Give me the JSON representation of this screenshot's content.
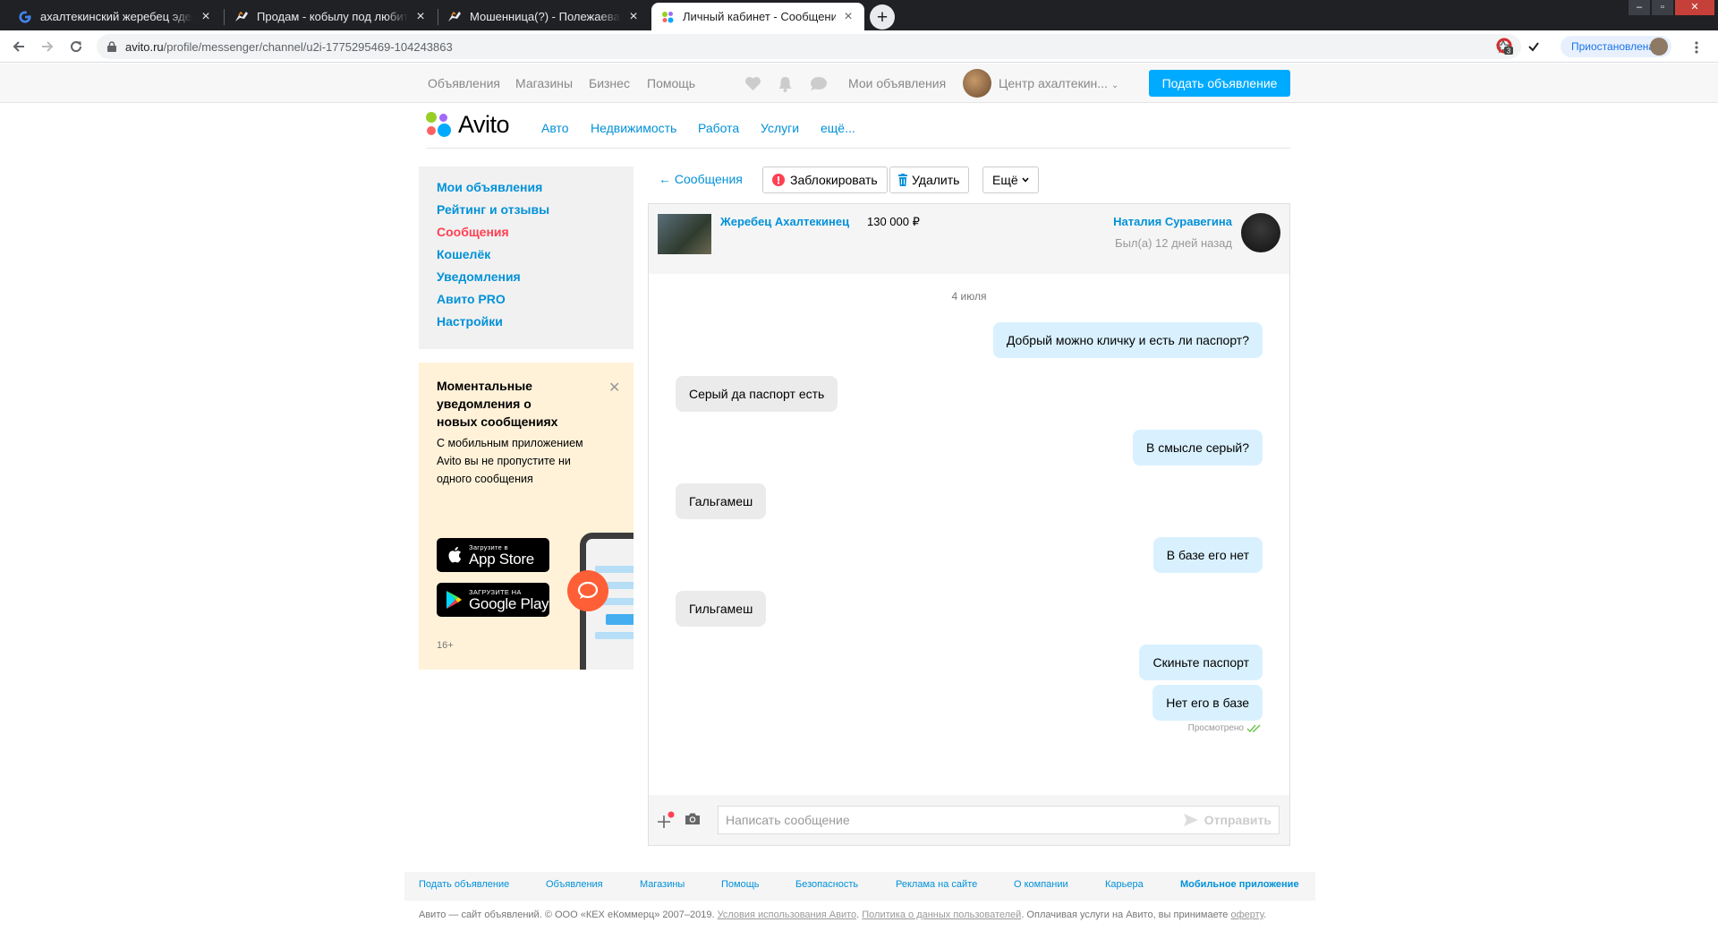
{
  "browser": {
    "tabs": [
      {
        "title": "ахалтекинский жеребец эдельвейс",
        "favicon": "google-icon"
      },
      {
        "title": "Продам - кобылу под любителя",
        "favicon": "horse-icon"
      },
      {
        "title": "Мошенница(?) - Полежаева Мария",
        "favicon": "horse-icon"
      },
      {
        "title": "Личный кабинет - Сообщения",
        "favicon": "avito-icon"
      }
    ],
    "url_host": "avito.ru",
    "url_path": "/profile/messenger/channel/u2i-1775295469-104243863",
    "ext_badge": "3",
    "profile_status": "Приостановлена"
  },
  "topbar": {
    "links": [
      "Объявления",
      "Магазины",
      "Бизнес",
      "Помощь"
    ],
    "my_ads": "Мои объявления",
    "user": "Центр ахалтекин...",
    "post_button": "Подать объявление"
  },
  "header": {
    "logo": "Avito",
    "nav": [
      "Авто",
      "Недвижимость",
      "Работа",
      "Услуги",
      "ещё..."
    ]
  },
  "sidebar": {
    "items": [
      "Мои объявления",
      "Рейтинг и отзывы",
      "Сообщения",
      "Кошелёк",
      "Уведомления",
      "Авито PRO",
      "Настройки"
    ],
    "active_index": 2
  },
  "promo": {
    "title": "Моментальные уведомления о новых сообщениях",
    "text": "С мобильным приложением Avito вы не пропустите ни одного сообщения",
    "appstore_small": "Загрузите в",
    "appstore_big": "App Store",
    "googleplay_small": "ЗАГРУЗИТЕ НА",
    "googleplay_big": "Google Play",
    "age": "16+"
  },
  "messenger": {
    "back": "← Сообщения",
    "block": "Заблокировать",
    "delete": "Удалить",
    "more": "Ещё",
    "item_title": "Жеребец Ахалтекинец",
    "item_price": "130 000 ₽",
    "user_name": "Наталия Суравегина",
    "user_seen": "Был(а) 12 дней назад",
    "date": "4 июля",
    "messages": [
      {
        "dir": "out",
        "text": "Добрый можно кличку и есть ли паспорт?"
      },
      {
        "dir": "in",
        "text": "Серый да паспорт есть"
      },
      {
        "dir": "out",
        "text": "В смысле серый?"
      },
      {
        "dir": "in",
        "text": "Гальгамеш"
      },
      {
        "dir": "out",
        "text": "В базе его нет"
      },
      {
        "dir": "in",
        "text": "Гильгамеш"
      },
      {
        "dir": "out",
        "text": "Скиньте паспорт"
      },
      {
        "dir": "out",
        "text": "Нет его в базе"
      }
    ],
    "seen_label": "Просмотрено",
    "input_placeholder": "Написать сообщение",
    "send": "Отправить"
  },
  "footer": {
    "links": [
      "Подать объявление",
      "Объявления",
      "Магазины",
      "Помощь",
      "Безопасность",
      "Реклама на сайте",
      "О компании",
      "Карьера",
      "Мобильное приложение"
    ],
    "copy_prefix": "Авито — сайт объявлений. © ООО «КЕХ еКоммерц» 2007–2019.",
    "terms": "Условия использования Авито",
    "privacy": "Политика о данных пользователей",
    "copy_suffix": ". Оплачивая услуги на Авито, вы принимаете",
    "offer": "оферту"
  },
  "colors": {
    "accent": "#0091d9",
    "active": "#ff4053",
    "post_button": "#00aaff",
    "bubble_out": "#d9f1ff",
    "bubble_in": "#ebebeb",
    "promo_bg": "#fff2d9"
  }
}
